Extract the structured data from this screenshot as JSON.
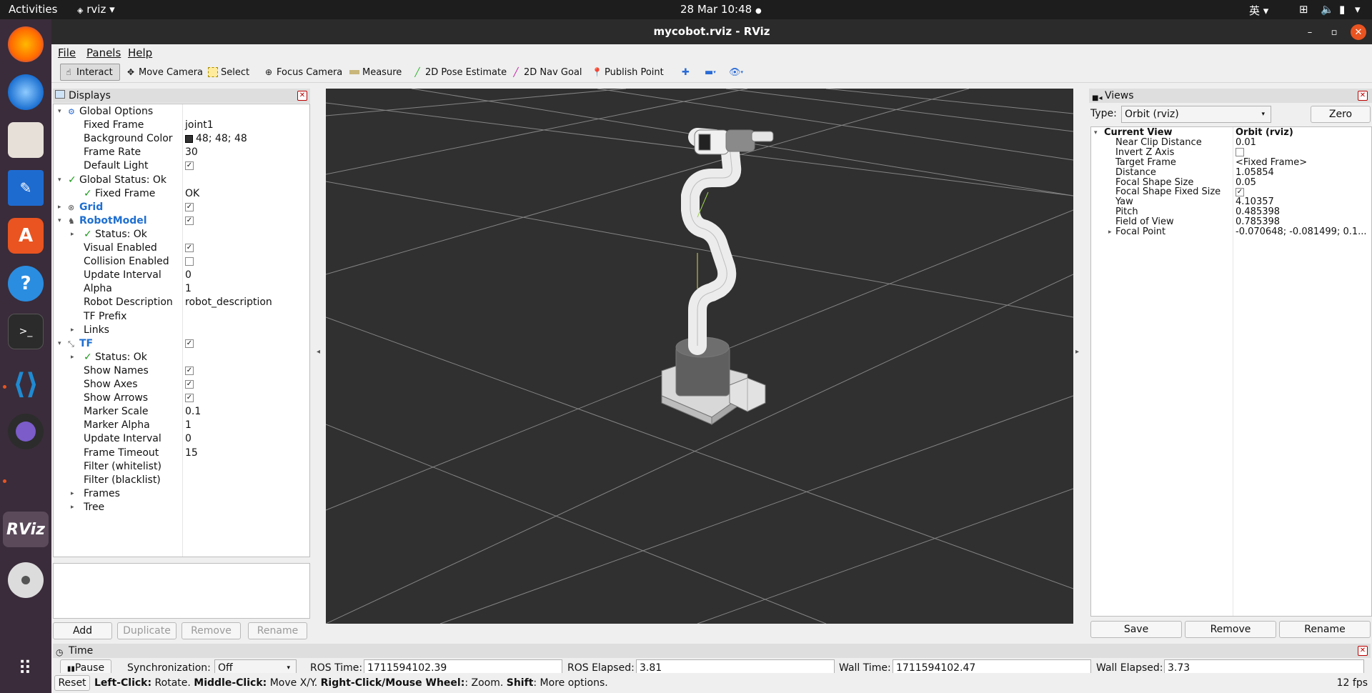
{
  "topbar": {
    "activities": "Activities",
    "app": "rviz",
    "clock": "28 Mar  10:48",
    "ime": "英"
  },
  "window": {
    "title": "mycobot.rviz - RViz"
  },
  "menu": {
    "file": "File",
    "panels": "Panels",
    "help": "Help"
  },
  "toolbar": {
    "interact": "Interact",
    "move_camera": "Move Camera",
    "select": "Select",
    "focus_camera": "Focus Camera",
    "measure": "Measure",
    "pose_estimate": "2D Pose Estimate",
    "nav_goal": "2D Nav Goal",
    "publish_point": "Publish Point"
  },
  "displays": {
    "title": "Displays",
    "rows": [
      {
        "label": "Global Options",
        "value": "",
        "indent": 0
      },
      {
        "label": "Fixed Frame",
        "value": "joint1"
      },
      {
        "label": "Background Color",
        "value": "48; 48; 48"
      },
      {
        "label": "Frame Rate",
        "value": "30"
      },
      {
        "label": "Default Light",
        "value": ""
      },
      {
        "label": "Global Status: Ok",
        "value": ""
      },
      {
        "label": "Fixed Frame",
        "value": "OK"
      },
      {
        "label": "Grid",
        "value": ""
      },
      {
        "label": "RobotModel",
        "value": ""
      },
      {
        "label": "Status: Ok",
        "value": ""
      },
      {
        "label": "Visual Enabled",
        "value": ""
      },
      {
        "label": "Collision Enabled",
        "value": ""
      },
      {
        "label": "Update Interval",
        "value": "0"
      },
      {
        "label": "Alpha",
        "value": "1"
      },
      {
        "label": "Robot Description",
        "value": "robot_description"
      },
      {
        "label": "TF Prefix",
        "value": ""
      },
      {
        "label": "Links",
        "value": ""
      },
      {
        "label": "TF",
        "value": ""
      },
      {
        "label": "Status: Ok",
        "value": ""
      },
      {
        "label": "Show Names",
        "value": ""
      },
      {
        "label": "Show Axes",
        "value": ""
      },
      {
        "label": "Show Arrows",
        "value": ""
      },
      {
        "label": "Marker Scale",
        "value": "0.1"
      },
      {
        "label": "Marker Alpha",
        "value": "1"
      },
      {
        "label": "Update Interval",
        "value": "0"
      },
      {
        "label": "Frame Timeout",
        "value": "15"
      },
      {
        "label": "Filter (whitelist)",
        "value": ""
      },
      {
        "label": "Filter (blacklist)",
        "value": ""
      },
      {
        "label": "Frames",
        "value": ""
      },
      {
        "label": "Tree",
        "value": ""
      }
    ],
    "buttons": {
      "add": "Add",
      "duplicate": "Duplicate",
      "remove": "Remove",
      "rename": "Rename"
    }
  },
  "views": {
    "title": "Views",
    "type_label": "Type:",
    "type_value": "Orbit (rviz)",
    "zero": "Zero",
    "rows": [
      {
        "label": "Current View",
        "value": "Orbit (rviz)"
      },
      {
        "label": "Near Clip Distance",
        "value": "0.01"
      },
      {
        "label": "Invert Z Axis",
        "value": ""
      },
      {
        "label": "Target Frame",
        "value": "<Fixed Frame>"
      },
      {
        "label": "Distance",
        "value": "1.05854"
      },
      {
        "label": "Focal Shape Size",
        "value": "0.05"
      },
      {
        "label": "Focal Shape Fixed Size",
        "value": ""
      },
      {
        "label": "Yaw",
        "value": "4.10357"
      },
      {
        "label": "Pitch",
        "value": "0.485398"
      },
      {
        "label": "Field of View",
        "value": "0.785398"
      },
      {
        "label": "Focal Point",
        "value": "-0.070648; -0.081499; 0.1..."
      }
    ],
    "buttons": {
      "save": "Save",
      "remove": "Remove",
      "rename": "Rename"
    }
  },
  "time": {
    "title": "Time",
    "pause": "Pause",
    "sync_label": "Synchronization:",
    "sync_value": "Off",
    "ros_time_label": "ROS Time:",
    "ros_time": "1711594102.39",
    "ros_elapsed_label": "ROS Elapsed:",
    "ros_elapsed": "3.81",
    "wall_time_label": "Wall Time:",
    "wall_time": "1711594102.47",
    "wall_elapsed_label": "Wall Elapsed:",
    "wall_elapsed": "3.73"
  },
  "status": {
    "reset": "Reset",
    "left_click": "Left-Click:",
    "left_click_desc": " Rotate. ",
    "middle_click": "Middle-Click:",
    "middle_click_desc": " Move X/Y. ",
    "right_click": "Right-Click/Mouse Wheel:",
    "right_click_desc": ": Zoom. ",
    "shift": "Shift",
    "shift_desc": ": More options.",
    "fps": "12 fps"
  },
  "colors": {
    "accent": "#e95420",
    "blue_label": "#1f6fd0",
    "bg_viewport": "#303030"
  }
}
